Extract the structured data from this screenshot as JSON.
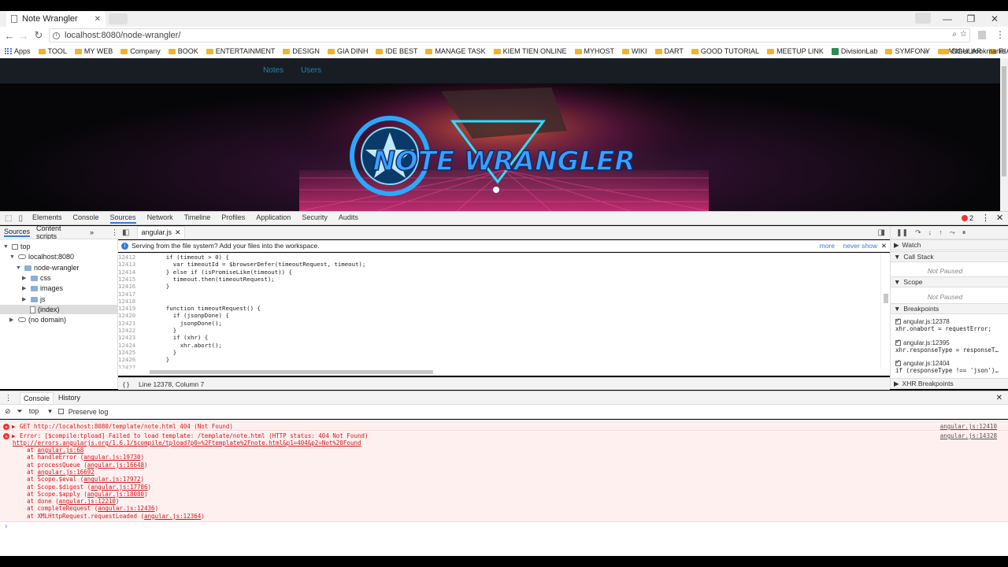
{
  "browser": {
    "tab_title": "Note Wrangler",
    "url": "localhost:8080/node-wrangler/",
    "window_controls": [
      "—",
      "❐",
      "✕"
    ]
  },
  "bookmarks": [
    "Apps",
    "TOOL",
    "MY WEB",
    "Company",
    "BOOK",
    "ENTERTAINMENT",
    "DESIGN",
    "GIA DINH",
    "IDE BEST",
    "MANAGE TASK",
    "KIEM TIEN ONLINE",
    "MYHOST",
    "WIKI",
    "DART",
    "GOOD TUTORIAL",
    "MEETUP LINK",
    "DivisionLab",
    "SYMFONY",
    "ANGULAR",
    "RIAK"
  ],
  "bookmarks_more": "»",
  "other_bookmarks": "Other bookmarks",
  "page": {
    "nav": [
      "Notes",
      "Users"
    ],
    "banner_title": "NOTE WRANGLER"
  },
  "devtools": {
    "tabs": [
      "Elements",
      "Console",
      "Sources",
      "Network",
      "Timeline",
      "Profiles",
      "Application",
      "Security",
      "Audits"
    ],
    "active_tab": "Sources",
    "error_count": "2",
    "nav_tabs": [
      "Sources",
      "Content scripts"
    ],
    "tree": {
      "top": "top",
      "host": "localhost:8080",
      "folder": "node-wrangler",
      "css": "css",
      "images": "images",
      "js": "js",
      "index": "(index)",
      "nodomain": "(no domain)"
    },
    "open_file": "angular.js",
    "infobar": {
      "message": "Serving from the file system? Add your files into the workspace.",
      "more": "more",
      "never_show": "never show"
    },
    "code": [
      {
        "n": "12412",
        "t": "    if (timeout > 0) {"
      },
      {
        "n": "12413",
        "t": "      var timeoutId = $browserDefer(timeoutRequest, timeout);"
      },
      {
        "n": "12414",
        "t": "    } else if (isPromiseLike(timeout)) {"
      },
      {
        "n": "12415",
        "t": "      timeout.then(timeoutRequest);"
      },
      {
        "n": "12416",
        "t": "    }"
      },
      {
        "n": "12417",
        "t": ""
      },
      {
        "n": "12418",
        "t": ""
      },
      {
        "n": "12419",
        "t": "    function timeoutRequest() {"
      },
      {
        "n": "12420",
        "t": "      if (jsonpDone) {"
      },
      {
        "n": "12421",
        "t": "        jsonpDone();"
      },
      {
        "n": "12422",
        "t": "      }"
      },
      {
        "n": "12423",
        "t": "      if (xhr) {"
      },
      {
        "n": "12424",
        "t": "        xhr.abort();"
      },
      {
        "n": "12425",
        "t": "      }"
      },
      {
        "n": "12426",
        "t": "    }"
      },
      {
        "n": "12427",
        "t": ""
      }
    ],
    "status": "Line 12378, Column 7",
    "debugger": {
      "watch": "Watch",
      "call_stack": "Call Stack",
      "not_paused": "Not Paused",
      "scope": "Scope",
      "breakpoints": "Breakpoints",
      "bp": [
        {
          "loc": "angular.js:12378",
          "code": "xhr.onabort = requestError;"
        },
        {
          "loc": "angular.js:12395",
          "code": "xhr.responseType = responseT…"
        },
        {
          "loc": "angular.js:12404",
          "code": "if (responseType !== 'json')…"
        }
      ],
      "xhr_breakpoints": "XHR Breakpoints"
    }
  },
  "console": {
    "tabs": [
      "Console",
      "History"
    ],
    "context": "top",
    "preserve_log": "Preserve log",
    "error1": {
      "text": "GET http://localhost:8080/template/note.html 404 (Not Found)",
      "src": "angular.js:12410"
    },
    "error2": {
      "text": "Error: [$compile:tpload] Failed to load template: /template/note.html (HTTP status: 404 Not Found)",
      "url": "http://errors.angularjs.org/1.6.1/$compile/tpload?p0=%2Ftemplate%2Fnote.html&p1=404&p2=Not%20Found",
      "src": "angular.js:14328",
      "stack": [
        {
          "fn": "at ",
          "link": "angular.js:68"
        },
        {
          "fn": "at handleError (",
          "link": "angular.js:19730",
          "close": ")"
        },
        {
          "fn": "at processQueue (",
          "link": "angular.js:16648",
          "close": ")"
        },
        {
          "fn": "at ",
          "link": "angular.js:16692"
        },
        {
          "fn": "at Scope.$eval (",
          "link": "angular.js:17972",
          "close": ")"
        },
        {
          "fn": "at Scope.$digest (",
          "link": "angular.js:17786",
          "close": ")"
        },
        {
          "fn": "at Scope.$apply (",
          "link": "angular.js:18080",
          "close": ")"
        },
        {
          "fn": "at done (",
          "link": "angular.js:12210",
          "close": ")"
        },
        {
          "fn": "at completeRequest (",
          "link": "angular.js:12436",
          "close": ")"
        },
        {
          "fn": "at XMLHttpRequest.requestLoaded (",
          "link": "angular.js:12364",
          "close": ")"
        }
      ]
    },
    "prompt": "›"
  }
}
